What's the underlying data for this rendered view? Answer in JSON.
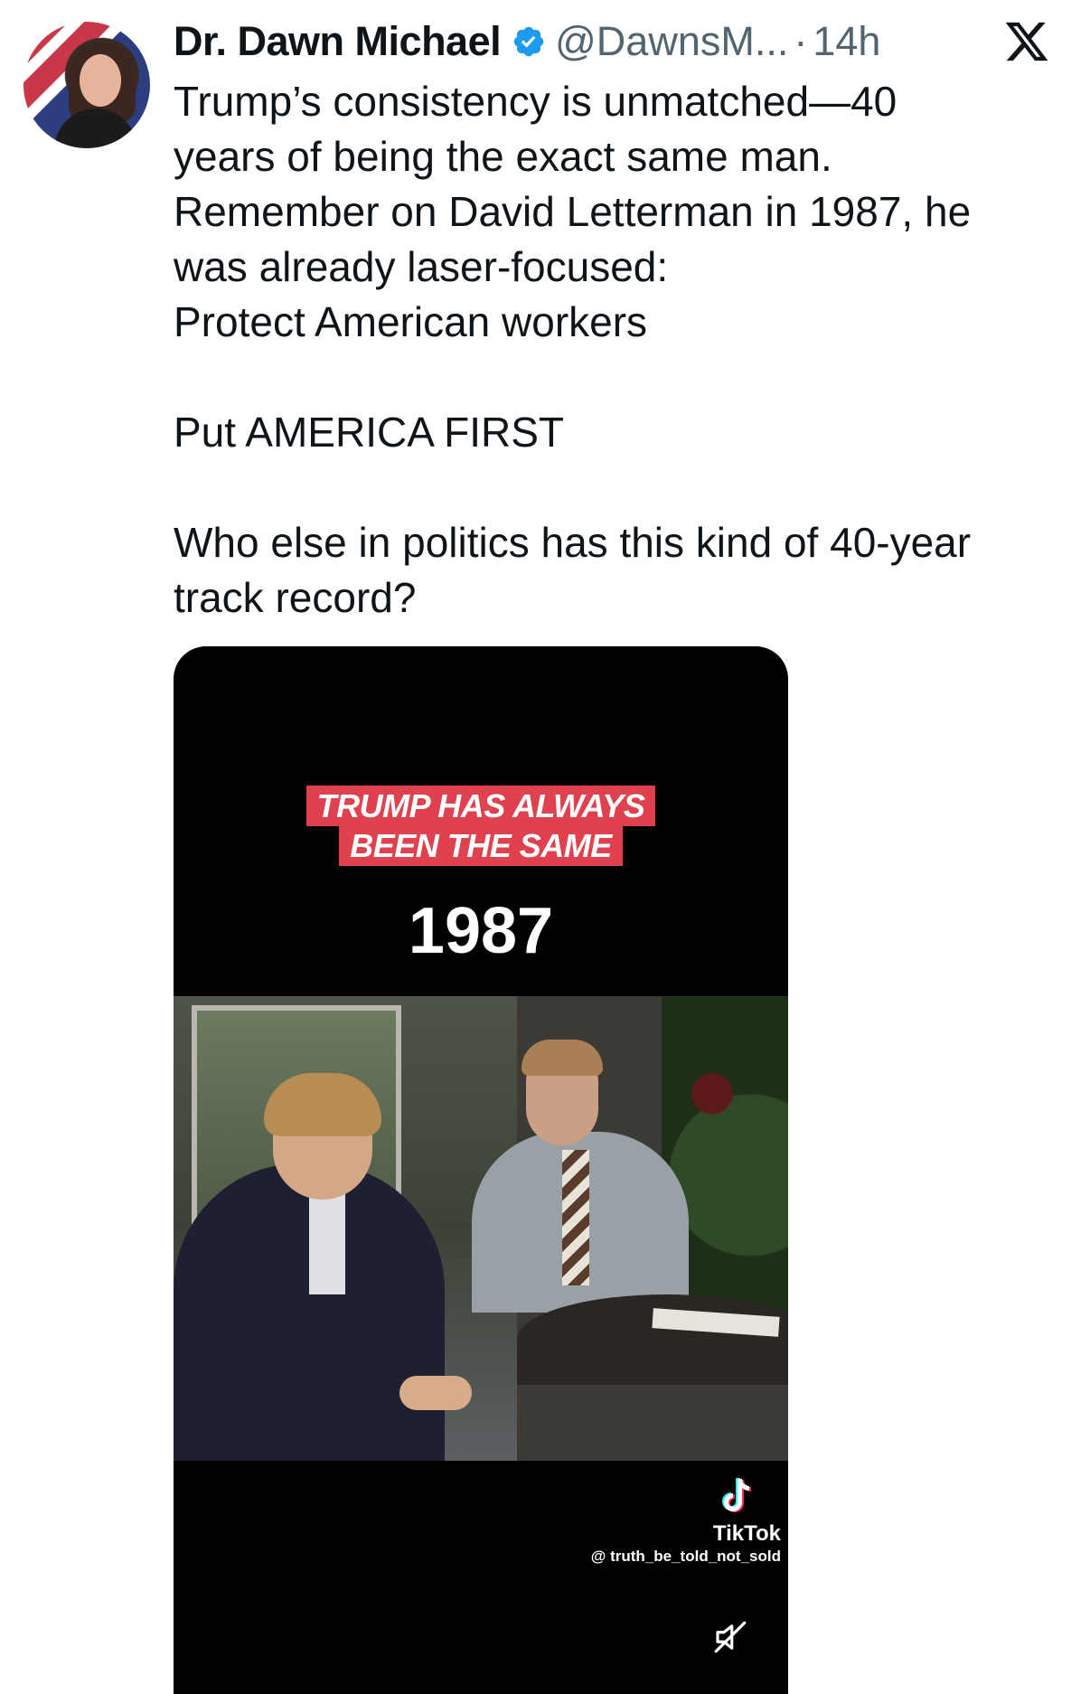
{
  "post": {
    "display_name": "Dr. Dawn Michael",
    "handle": "@DawnsM...",
    "separator": "·",
    "time": "14h",
    "text": "Trump’s consistency is unmatched—40\nyears of being the exact same man.\nRemember on David Letterman in 1987, he\nwas already laser-focused:\nProtect American workers\n\nPut AMERICA FIRST\n\nWho else in politics has this kind of 40-year\ntrack record?"
  },
  "video": {
    "banner_line1": "TRUMP HAS ALWAYS",
    "banner_line2": "BEEN THE SAME",
    "year": "1987",
    "watermark_brand": "TikTok",
    "watermark_user": "@ truth_be_told_not_sold"
  },
  "icons": {
    "verified": "verified-badge-icon",
    "close": "x-logo-icon",
    "mute": "muted-speaker-icon",
    "tiktok": "tiktok-logo-icon"
  },
  "colors": {
    "verified_blue": "#1d9bf0",
    "secondary_text": "#536471",
    "banner_red": "#e0414e"
  }
}
